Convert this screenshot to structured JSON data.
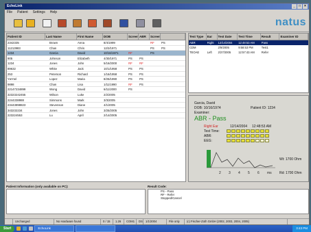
{
  "window": {
    "title": "EchoLink"
  },
  "menu": [
    "File",
    "Patient",
    "Settings",
    "Help"
  ],
  "brand": "natus",
  "toolbar": [
    {
      "icon": "new-folder-icon",
      "color": "#e8c040"
    },
    {
      "icon": "open-folder-icon",
      "color": "#e8b020"
    },
    {
      "icon": "document-icon",
      "color": "#f2f2f2"
    },
    {
      "icon": "patient-icon",
      "color": "#b84a2a"
    },
    {
      "icon": "transfer-icon",
      "color": "#c07a30"
    },
    {
      "icon": "ear-icon",
      "color": "#d05a30"
    },
    {
      "icon": "patient-search-icon",
      "color": "#a04a2a"
    },
    {
      "icon": "save-icon",
      "color": "#3050a0"
    },
    {
      "icon": "audio-icon",
      "color": "#9090a0"
    },
    {
      "icon": "print-icon",
      "color": "#606060"
    }
  ],
  "patients": {
    "columns": [
      "Patient ID",
      "Last Name",
      "First Name",
      "DOB",
      "Screen",
      "ABR",
      "Screen",
      ""
    ],
    "rows": [
      [
        "2342335",
        "Brown",
        "Anna",
        "8/4/1999",
        "",
        "",
        "RF",
        "PS"
      ],
      [
        "11213983",
        "Chan",
        "Chris",
        "12/2/1971",
        "",
        "",
        "PS",
        "PS"
      ],
      [
        "1234",
        "Garcia",
        "David",
        "10/16/1971",
        "RF",
        "",
        "PS",
        ""
      ],
      [
        "905",
        "Johnson",
        "Elizabeth",
        "4/30/1971",
        "PS",
        "PS",
        "",
        ""
      ],
      [
        "1234",
        "Jones",
        "John",
        "5/16/2000",
        "RF",
        "RF",
        "",
        ""
      ],
      [
        "89632",
        "White",
        "Jack",
        "10/1/1958",
        "PS",
        "PS",
        "",
        ""
      ],
      [
        "253",
        "Peterson",
        "Richard",
        "1/16/1958",
        "PS",
        "PS",
        "",
        ""
      ],
      [
        "YwYwl",
        "Lopez",
        "Maria",
        "8/25/1990",
        "PS",
        "PS",
        "",
        ""
      ],
      [
        "9898",
        "Chan",
        "Lisa",
        "1/11/1990",
        "RF",
        "PS",
        "",
        ""
      ],
      [
        "22147234899",
        "Wong",
        "David",
        "6/11/2000",
        "PS",
        "",
        "",
        ""
      ],
      [
        "32323242455",
        "Wilson",
        "Luke",
        "2/2/2005",
        "",
        "",
        "",
        ""
      ],
      [
        "2244338988",
        "Simmons",
        "Mark",
        "3/3/2005",
        "",
        "",
        "",
        ""
      ],
      [
        "23443898823",
        "Stevenson",
        "Diane",
        "4/1/2005",
        "",
        "",
        "",
        ""
      ],
      [
        "343232234",
        "Jones",
        "John",
        "3/25/2005",
        "",
        "",
        "",
        ""
      ],
      [
        "223224553",
        "Lu",
        "April",
        "2/14/2005",
        "",
        "",
        "",
        ""
      ]
    ],
    "selected_index": 2
  },
  "tests": {
    "columns": [
      "Test Type",
      "Ear",
      "Test Date",
      "Test Time",
      "Result",
      "Examiner ID"
    ],
    "rows": [
      [
        "ABR",
        "Right",
        "12/14/2004",
        "12:48:53 AM",
        "Pass",
        ""
      ],
      [
        "CDM",
        "",
        "2/9/2005",
        "9:58:53 PM",
        "Test1",
        ""
      ],
      [
        "TEOAE",
        "Left",
        "2/27/2005",
        "12:57:43 AM",
        "Refer",
        ""
      ]
    ],
    "selected_index": 0
  },
  "detail": {
    "name": "Garcia, David",
    "dob_label": "DOB: 10/16/1974",
    "patient_id_label": "Patient ID: 1234",
    "examiner_label": "Examiner:",
    "result": "ABR - Pass",
    "ear": "Right Ear",
    "date": "12/14/2004",
    "time": "12:48:53 AM",
    "test_time_label": "Test Time:",
    "abr_label": "ABR:",
    "eeg_label": "EEG:",
    "wt": "Wt:  1700  Ohm",
    "rd": "Rd:  1700  Ohm",
    "axis_ticks": [
      "2",
      "3",
      "4",
      "5",
      "6",
      "ms"
    ],
    "abr_level": 0.95
  },
  "patient_info": {
    "label": "Patient Information (only available on PC):"
  },
  "result_code": {
    "label": "Result Code:",
    "lines": [
      "PS - Pass",
      "RF - Refer",
      "Stopped/Cancel"
    ]
  },
  "status": [
    "",
    "Unchanged",
    "No Hardware found",
    "0 / 15",
    "1.26",
    "COM1",
    "DS",
    "1/1/2004",
    "File only",
    "(c) Fischer-Zoth GmbH (2002, 2003, 2004, 2005)"
  ],
  "taskbar": {
    "start": "Start",
    "tasks": [
      "EchoLink",
      ""
    ],
    "clock": "3:43 PM"
  },
  "colors": {
    "accent": "#0a246a",
    "selected_row": "#9bb5cd",
    "pass": "#1e8e1e",
    "refer": "#d22222",
    "bars": "#e8e038"
  }
}
